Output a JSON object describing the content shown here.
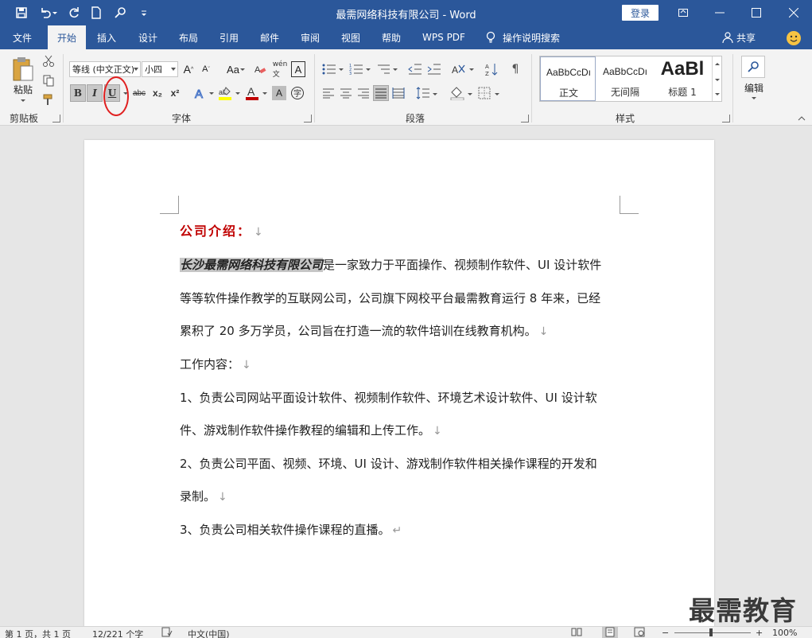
{
  "window": {
    "title": "最需网络科技有限公司 - Word",
    "login_label": "登录"
  },
  "ribbon_tabs": [
    {
      "label": "文件",
      "active": false
    },
    {
      "label": "开始",
      "active": true
    },
    {
      "label": "插入",
      "active": false
    },
    {
      "label": "设计",
      "active": false
    },
    {
      "label": "布局",
      "active": false
    },
    {
      "label": "引用",
      "active": false
    },
    {
      "label": "邮件",
      "active": false
    },
    {
      "label": "审阅",
      "active": false
    },
    {
      "label": "视图",
      "active": false
    },
    {
      "label": "帮助",
      "active": false
    },
    {
      "label": "WPS PDF",
      "active": false
    }
  ],
  "tell_me": "操作说明搜索",
  "share_label": "共享",
  "ribbon": {
    "clipboard": {
      "paste_label": "粘贴",
      "group_label": "剪贴板"
    },
    "font": {
      "font_name": "等线 (中文正文)",
      "font_size": "小四",
      "group_label": "字体",
      "bold_label": "B",
      "italic_label": "I",
      "underline_label": "U",
      "strike_label": "abc",
      "sub_label": "x₂",
      "sup_label": "x²"
    },
    "paragraph": {
      "group_label": "段落"
    },
    "styles": {
      "group_label": "样式",
      "items": [
        {
          "sample": "AaBbCcDı",
          "name": "正文"
        },
        {
          "sample": "AaBbCcDı",
          "name": "无间隔"
        },
        {
          "sample": "AaBl",
          "name": "标题 1"
        }
      ]
    },
    "editing": {
      "label": "编辑"
    }
  },
  "document": {
    "heading": "公司介绍：",
    "company_name": "长沙最需网络科技有限公司",
    "p1_line1_rest": "是一家致力于平面操作、视频制作软件、UI 设计软件",
    "p1_line2": "等等软件操作教学的互联网公司，公司旗下网校平台最需教育运行 8 年来，已经",
    "p1_line3": "累积了 20 多万学员，公司旨在打造一流的软件培训在线教育机构。",
    "work_title": "工作内容：",
    "item1_line1": "1、负责公司网站平面设计软件、视频制作软件、环境艺术设计软件、UI 设计软",
    "item1_line2": "件、游戏制作软件操作教程的编辑和上传工作。",
    "item2_line1": "2、负责公司平面、视频、环境、UI 设计、游戏制作软件相关操作课程的开发和",
    "item2_line2": "录制。",
    "item3": "3、负责公司相关软件操作课程的直播。",
    "line_break_mark": "↓",
    "paragraph_mark": "↵"
  },
  "watermark": "最需教育",
  "status": {
    "page": "第 1 页，共 1 页",
    "words": "12/221 个字",
    "language": "中文(中国)",
    "zoom": "100%",
    "zoom_minus": "−",
    "zoom_plus": "+"
  },
  "colors": {
    "title_blue": "#2b579a",
    "heading_red": "#c00000",
    "highlight_gray": "#c6c6c6",
    "annotation_red": "#e02020"
  }
}
